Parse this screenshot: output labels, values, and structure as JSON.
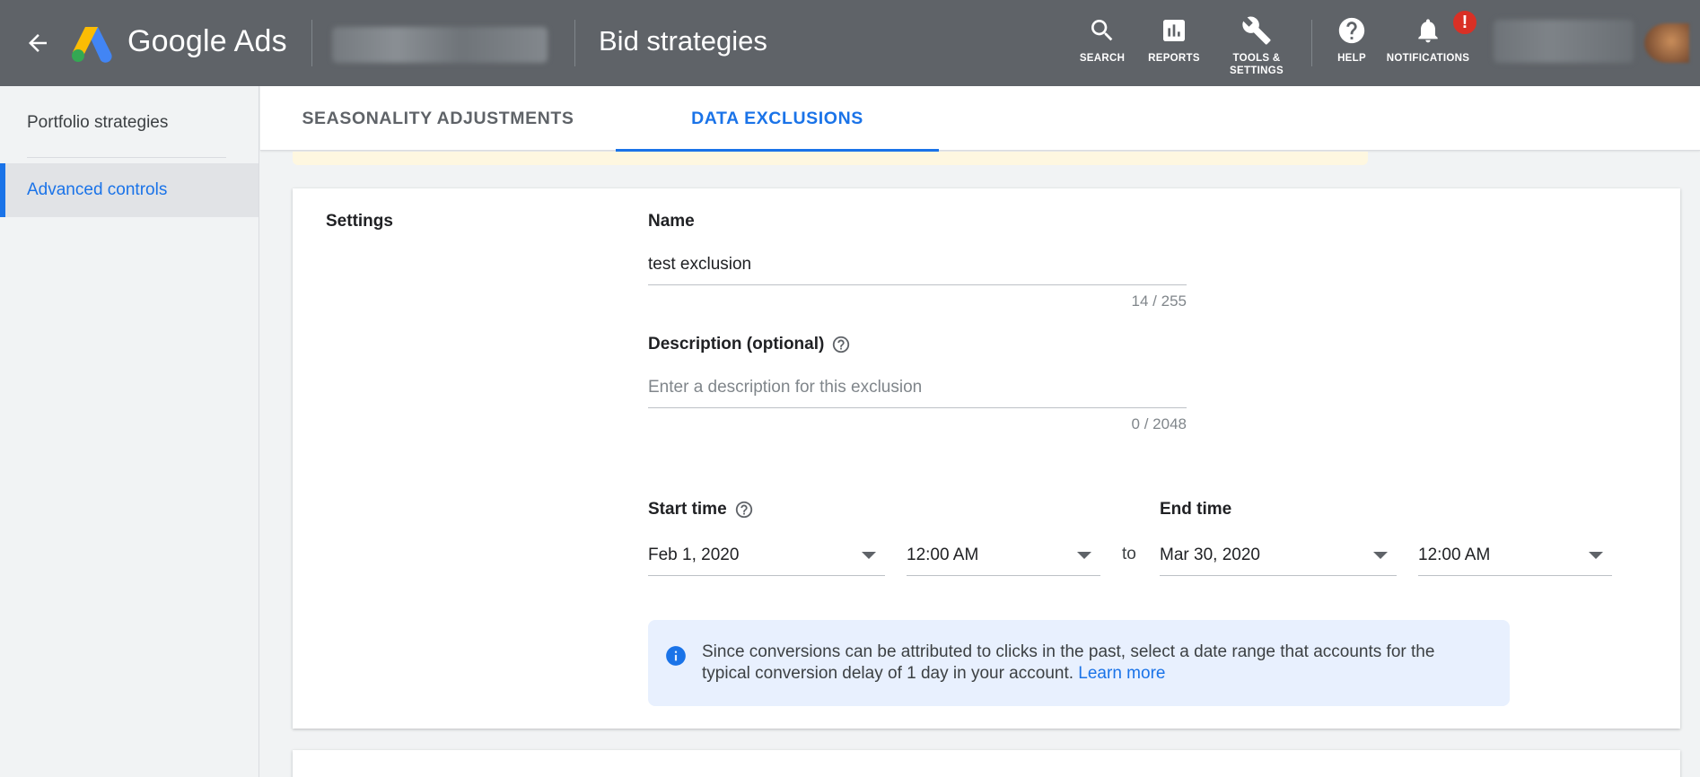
{
  "app": {
    "product_name": "Google Ads",
    "page_title": "Bid strategies"
  },
  "header_actions": [
    {
      "name": "search",
      "label": "SEARCH"
    },
    {
      "name": "reports",
      "label": "REPORTS"
    },
    {
      "name": "tools",
      "label": "TOOLS & SETTINGS"
    },
    {
      "name": "help",
      "label": "HELP"
    },
    {
      "name": "notifications",
      "label": "NOTIFICATIONS",
      "badge": "!"
    }
  ],
  "sidebar": {
    "items": [
      {
        "label": "Portfolio strategies",
        "active": false
      },
      {
        "label": "Advanced controls",
        "active": true
      }
    ]
  },
  "tabs": [
    {
      "label": "SEASONALITY ADJUSTMENTS",
      "active": false
    },
    {
      "label": "DATA EXCLUSIONS",
      "active": true
    }
  ],
  "form": {
    "section_label": "Settings",
    "name": {
      "label": "Name",
      "value": "test exclusion",
      "counter": "14 / 255"
    },
    "description": {
      "label": "Description (optional)",
      "placeholder": "Enter a description for this exclusion",
      "value": "",
      "counter": "0 / 2048"
    },
    "start_time": {
      "label": "Start time",
      "date": "Feb 1, 2020",
      "time": "12:00 AM"
    },
    "separator": "to",
    "end_time": {
      "label": "End time",
      "date": "Mar 30, 2020",
      "time": "12:00 AM"
    },
    "info": {
      "text": "Since conversions can be attributed to clicks in the past, select a date range that accounts for the typical conversion delay of 1 day in your account.",
      "link": "Learn more"
    }
  },
  "colors": {
    "header_bg": "#5f6368",
    "accent": "#1a73e8",
    "info_bg": "#e8f0fe",
    "badge": "#d93025"
  }
}
